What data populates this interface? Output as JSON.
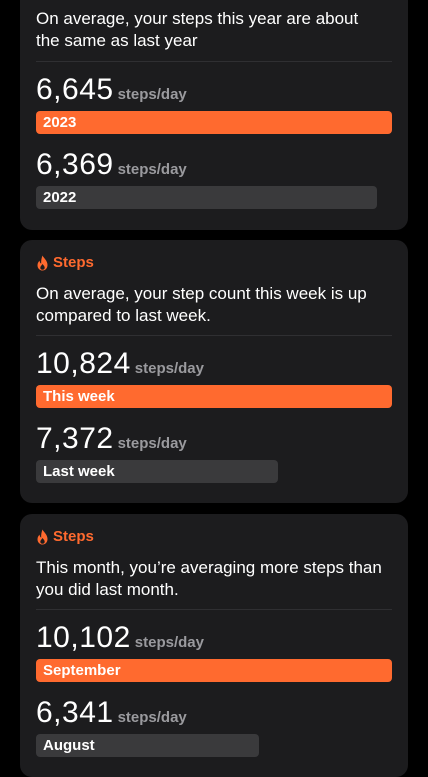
{
  "cards": [
    {
      "header": "",
      "description": "On average, your steps this year are about the same as last year",
      "current": {
        "value": "6,645",
        "unit": "steps/day",
        "label": "2023",
        "fill": 1.0
      },
      "previous": {
        "value": "6,369",
        "unit": "steps/day",
        "label": "2022",
        "fill": 0.96
      }
    },
    {
      "header": "Steps",
      "description": "On average, your step count this week is up compared to last week.",
      "current": {
        "value": "10,824",
        "unit": "steps/day",
        "label": "This week",
        "fill": 1.0
      },
      "previous": {
        "value": "7,372",
        "unit": "steps/day",
        "label": "Last week",
        "fill": 0.68
      }
    },
    {
      "header": "Steps",
      "description": "This month, you’re averaging more steps than you did last month.",
      "current": {
        "value": "10,102",
        "unit": "steps/day",
        "label": "September",
        "fill": 1.0
      },
      "previous": {
        "value": "6,341",
        "unit": "steps/day",
        "label": "August",
        "fill": 0.63
      }
    }
  ],
  "colors": {
    "accent": "#ff6a2f",
    "muted_bar": "#3a3a3c",
    "card": "#1c1c1e",
    "unit_text": "#9a9a9e"
  },
  "icons": {
    "header": "flame-icon"
  }
}
